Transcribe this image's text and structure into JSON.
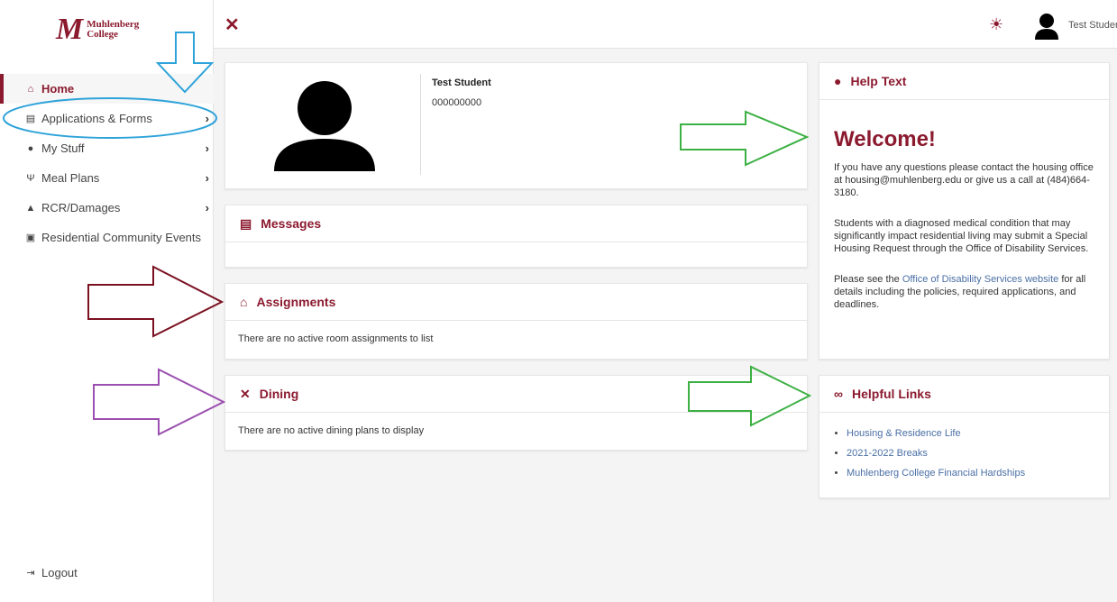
{
  "brand": {
    "logo_letter": "M",
    "name_line1": "Muhlenberg",
    "name_line2": "College"
  },
  "sidebar": {
    "items": [
      {
        "label": "Home",
        "icon": "home-icon",
        "glyph": "⌂",
        "active": true,
        "chevron": false
      },
      {
        "label": "Applications & Forms",
        "icon": "forms-icon",
        "glyph": "▤",
        "active": false,
        "chevron": true
      },
      {
        "label": "My Stuff",
        "icon": "user-icon",
        "glyph": "●",
        "active": false,
        "chevron": true
      },
      {
        "label": "Meal Plans",
        "icon": "utensils-icon",
        "glyph": "Ψ",
        "active": false,
        "chevron": true
      },
      {
        "label": "RCR/Damages",
        "icon": "warning-icon",
        "glyph": "▲",
        "active": false,
        "chevron": true
      },
      {
        "label": "Residential Community Events",
        "icon": "ticket-icon",
        "glyph": "▣",
        "active": false,
        "chevron": false
      }
    ],
    "logout_label": "Logout"
  },
  "topbar": {
    "close_glyph": "✕",
    "theme_glyph": "☀",
    "user_name": "Test Studer"
  },
  "profile": {
    "name": "Test Student",
    "id": "000000000"
  },
  "messages": {
    "title": "Messages"
  },
  "assignments": {
    "title": "Assignments",
    "empty_text": "There are no active room assignments to list"
  },
  "dining": {
    "title": "Dining",
    "empty_text": "There are no active dining plans to display"
  },
  "help": {
    "title": "Help Text",
    "welcome": "Welcome!",
    "para1": "If you have any questions please contact the housing office at housing@muhlenberg.edu or give us a call at (484)664-3180.",
    "para2": "Students with a diagnosed medical condition that may significantly impact residential living may submit a Special Housing Request through the Office of Disability Services.",
    "para3_before": "Please see the ",
    "para3_link": "Office of Disability Services website",
    "para3_after": " for all details including the policies, required applications, and deadlines."
  },
  "helpful_links": {
    "title": "Helpful Links",
    "items": [
      "Housing & Residence Life",
      "2021-2022 Breaks",
      "Muhlenberg College Financial Hardships"
    ]
  },
  "colors": {
    "accent": "#8b1a2f",
    "annot_blue": "#2ea3d9",
    "annot_green": "#3cb043",
    "annot_maroon": "#7a1020",
    "annot_purple": "#9b4fb0"
  }
}
